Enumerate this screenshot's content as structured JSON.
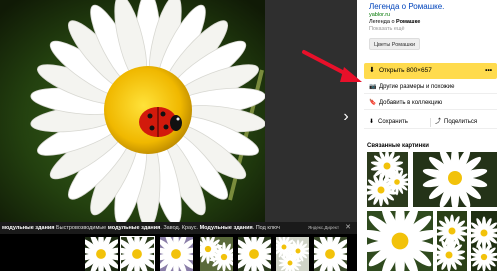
{
  "viewer": {
    "next_icon": "chevron-right-icon",
    "ad": {
      "segments": [
        {
          "text": "модульные здания",
          "bold": true
        },
        {
          "text": " Быстровозводимые ",
          "bold": false
        },
        {
          "text": "модульные здания",
          "bold": true
        },
        {
          "text": ". Завод. Краус. ",
          "bold": false
        },
        {
          "text": "Модульные здания",
          "bold": true
        },
        {
          "text": ". Под ключ",
          "bold": false
        }
      ],
      "tag": "Яндекс.Директ",
      "close": "✕"
    },
    "thumbnails": [
      "daisy-1",
      "daisy-2",
      "daisy-3",
      "daisy-4",
      "daisy-5",
      "daisy-6",
      "daisy-7"
    ]
  },
  "side": {
    "title": "Легенда о Ромашке.",
    "domain": "yablor.ru",
    "snippet_prefix": "Легенда о ",
    "snippet_bold": "Ромашке",
    "more": "Показать ещё",
    "tag_button": "Цветы Ромашки",
    "open_button": {
      "label": "Открыть  800×657",
      "icon": "download-icon",
      "more": "•••"
    },
    "actions": [
      {
        "label": "Другие размеры и похожие",
        "icon": "camera-icon"
      },
      {
        "label": "Добавить в коллекцию",
        "icon": "bookmark-icon"
      }
    ],
    "save": {
      "label": "Сохранить",
      "icon": "save-icon"
    },
    "share": {
      "label": "Поделиться",
      "icon": "share-icon"
    },
    "related_title": "Связанные картинки"
  },
  "colors": {
    "accent": "#ffdb4d",
    "link": "#0044bb",
    "domain": "#007700",
    "arrow": "#e8102a"
  }
}
